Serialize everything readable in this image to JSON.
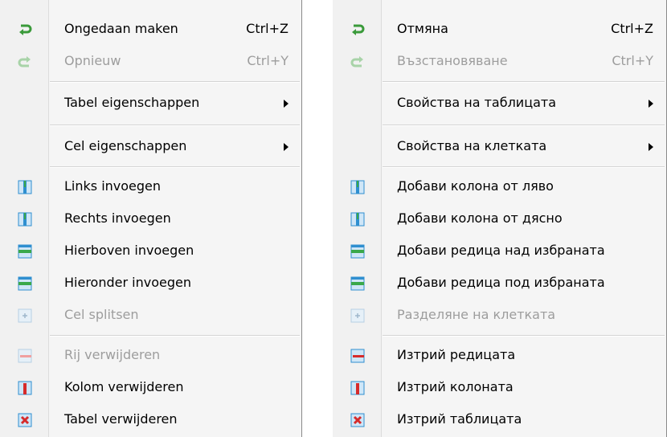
{
  "colors": {
    "undo": "#3a9a3a",
    "disabled": "#9d9d9d",
    "delete": "#d62b2b",
    "insert": "#2f8fd0"
  },
  "left_menu": {
    "items": [
      {
        "label": "Ongedaan maken",
        "shortcut": "Ctrl+Z",
        "icon": "undo-icon",
        "disabled": false
      },
      {
        "label": "Opnieuw",
        "shortcut": "Ctrl+Y",
        "icon": "redo-icon",
        "disabled": true
      },
      {
        "label": "Tabel eigenschappen",
        "submenu": true
      },
      {
        "label": "Cel eigenschappen",
        "submenu": true
      },
      {
        "label": "Links invoegen",
        "icon": "insert-column-left-icon"
      },
      {
        "label": "Rechts invoegen",
        "icon": "insert-column-right-icon"
      },
      {
        "label": "Hierboven invoegen",
        "icon": "insert-row-above-icon"
      },
      {
        "label": "Hieronder invoegen",
        "icon": "insert-row-below-icon"
      },
      {
        "label": "Cel splitsen",
        "icon": "split-cell-icon",
        "disabled": true
      },
      {
        "label": "Rij verwijderen",
        "icon": "delete-row-icon",
        "disabled": true
      },
      {
        "label": "Kolom verwijderen",
        "icon": "delete-column-icon"
      },
      {
        "label": "Tabel verwijderen",
        "icon": "delete-table-icon"
      }
    ]
  },
  "right_menu": {
    "items": [
      {
        "label": "Отмяна",
        "shortcut": "Ctrl+Z",
        "icon": "undo-icon",
        "disabled": false
      },
      {
        "label": "Възстановяване",
        "shortcut": "Ctrl+Y",
        "icon": "redo-icon",
        "disabled": true
      },
      {
        "label": "Свойства на таблицата",
        "submenu": true
      },
      {
        "label": "Свойства на клетката",
        "submenu": true
      },
      {
        "label": "Добави колона от ляво",
        "icon": "insert-column-left-icon"
      },
      {
        "label": "Добави колона от дясно",
        "icon": "insert-column-right-icon"
      },
      {
        "label": "Добави редица над избраната",
        "icon": "insert-row-above-icon"
      },
      {
        "label": "Добави редица под избраната",
        "icon": "insert-row-below-icon"
      },
      {
        "label": "Разделяне на клетката",
        "icon": "split-cell-icon",
        "disabled": true
      },
      {
        "label": "Изтрий редицата",
        "icon": "delete-row-icon",
        "disabled": false
      },
      {
        "label": "Изтрий колоната",
        "icon": "delete-column-icon"
      },
      {
        "label": "Изтрий таблицата",
        "icon": "delete-table-icon"
      }
    ]
  }
}
